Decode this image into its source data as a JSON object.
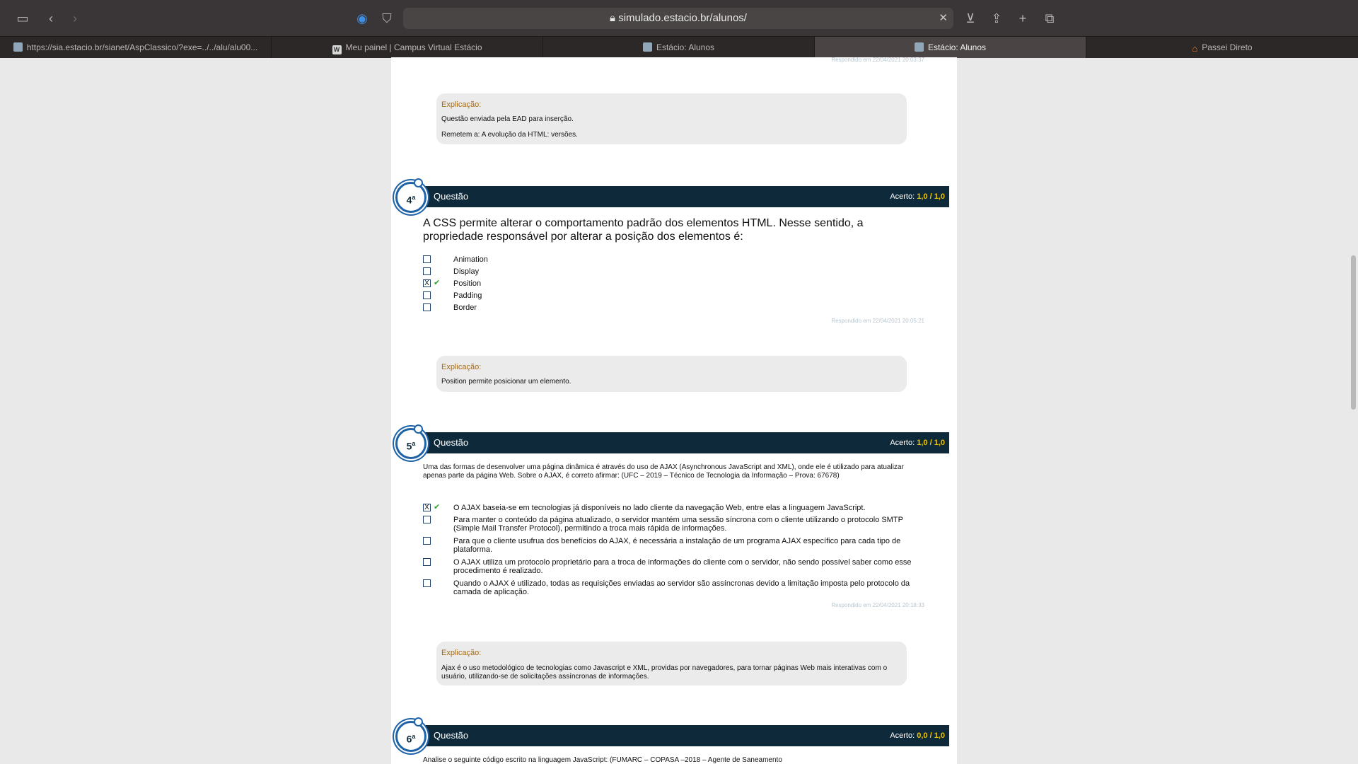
{
  "browser": {
    "url": "simulado.estacio.br/alunos/",
    "tabs": [
      {
        "label": "https://sia.estacio.br/sianet/AspClassico/?exe=../../alu/alu00..."
      },
      {
        "label": "Meu painel | Campus Virtual Estácio"
      },
      {
        "label": "Estácio: Alunos"
      },
      {
        "label": "Estácio: Alunos"
      },
      {
        "label": "Passei Direto"
      }
    ]
  },
  "top_remnant": {
    "responded": "Respondido em 22/04/2021 20:03:37",
    "explanation_title": "Explicação:",
    "explanation_lines": [
      "Questão enviada pela EAD para inserção.",
      "Remetem a: A evolução da HTML: versões."
    ]
  },
  "questions": [
    {
      "number": "4",
      "title": "Questão",
      "score_label": "Acerto:",
      "score_value": "1,0",
      "score_total": "/ 1,0",
      "text": "A CSS permite alterar o comportamento padrão dos elementos HTML. Nesse sentido, a propriedade responsável por alterar a posição dos elementos é:",
      "options": [
        {
          "label": "Animation",
          "mark": ""
        },
        {
          "label": "Display",
          "mark": ""
        },
        {
          "label": "Position",
          "mark": "X"
        },
        {
          "label": "Padding",
          "mark": ""
        },
        {
          "label": "Border",
          "mark": ""
        }
      ],
      "responded": "Respondido em 22/04/2021 20:05:21",
      "explanation_title": "Explicação:",
      "explanation": "Position permite posicionar um elemento."
    },
    {
      "number": "5",
      "title": "Questão",
      "score_label": "Acerto:",
      "score_value": "1,0",
      "score_total": "/ 1,0",
      "text": "Uma das formas de desenvolver uma página dinâmica é através do uso de AJAX (Asynchronous JavaScript and XML), onde ele é utilizado para atualizar apenas parte da página Web. Sobre o AJAX, é correto afirmar: (UFC ‒ 2019 ‒ Técnico de Tecnologia da Informação ‒ Prova: 67678)",
      "options": [
        {
          "label": "O AJAX baseia-se em tecnologias já disponíveis no lado cliente da navegação Web, entre elas a linguagem JavaScript.",
          "mark": "X"
        },
        {
          "label": "Para manter o conteúdo da página atualizado, o servidor mantém uma sessão síncrona com o cliente utilizando o protocolo SMTP (Simple Mail Transfer Protocol), permitindo a troca mais rápida de informações.",
          "mark": ""
        },
        {
          "label": "Para que o cliente usufrua dos benefícios do AJAX, é necessária a instalação de um programa AJAX específico para cada tipo de plataforma.",
          "mark": ""
        },
        {
          "label": " O AJAX utiliza um protocolo proprietário para a troca de informações do cliente com o servidor, não sendo possível saber como esse procedimento é realizado.",
          "mark": ""
        },
        {
          "label": "Quando o AJAX é utilizado, todas as requisições enviadas ao servidor são assíncronas devido a limitação imposta pelo protocolo da camada de aplicação.",
          "mark": ""
        }
      ],
      "responded": "Respondido em 22/04/2021 20:18:33",
      "explanation_title": "Explicação:",
      "explanation": "Ajax é o uso metodológico de tecnologias como Javascript e XML, providas por navegadores, para tornar páginas Web mais interativas com o usuário, utilizando-se de solicitações assíncronas de informações."
    },
    {
      "number": "6",
      "title": "Questão",
      "score_label": "Acerto:",
      "score_value": "0,0",
      "score_total": "/ 1,0",
      "text": "Analise o seguinte código escrito na linguagem JavaScript: (FUMARC ‒ COPASA ‒2018 ‒ Agente de Saneamento"
    }
  ],
  "colors": {
    "question_bar": "#0e2a3a",
    "score": "#f2c400",
    "badge_ring": "#1e62a8",
    "explanation_title": "#a26a1a",
    "check": "#2ea52e"
  }
}
